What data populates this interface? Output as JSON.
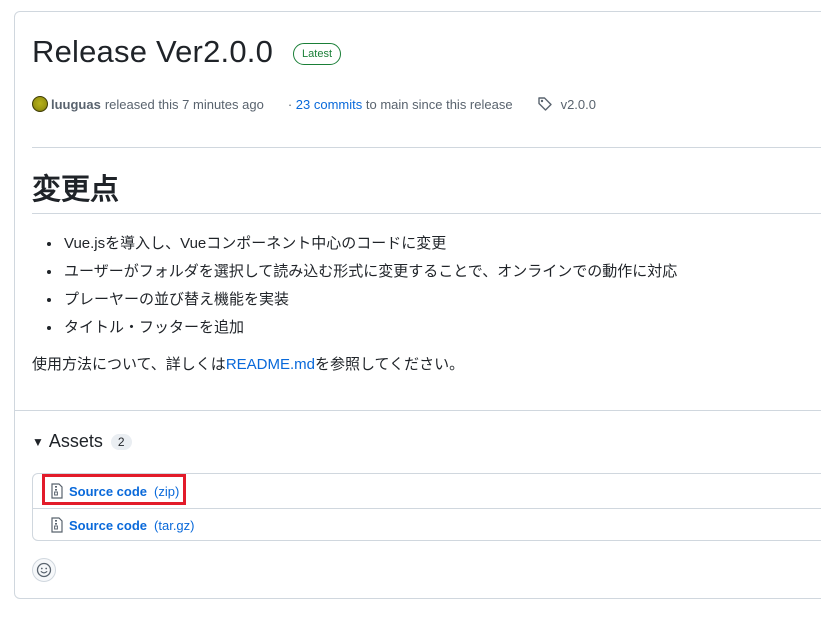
{
  "release": {
    "title": "Release Ver2.0.0",
    "badge": "Latest",
    "author": "luuguas",
    "released_text": "released this 7 minutes ago",
    "commits_prefix": "·",
    "commits_link": "23 commits",
    "commits_suffix": "to main since this release",
    "tag": "v2.0.0"
  },
  "notes": {
    "heading": "変更点",
    "bullets": [
      "Vue.jsを導入し、Vueコンポーネント中心のコードに変更",
      "ユーザーがフォルダを選択して読み込む形式に変更することで、オンラインでの動作に対応",
      "プレーヤーの並び替え機能を実装",
      "タイトル・フッターを追加"
    ],
    "usage_before": "使用方法について、詳しくは",
    "usage_link": "README.md",
    "usage_after": "を参照してください。"
  },
  "assets": {
    "label": "Assets",
    "count": "2",
    "items": [
      {
        "name": "Source code",
        "type": "(zip)"
      },
      {
        "name": "Source code",
        "type": "(tar.gz)"
      }
    ]
  },
  "icons": {
    "tag": "tag-icon",
    "zip": "file-zip-icon",
    "reaction": "smiley-icon",
    "caret": "triangle-down-icon"
  },
  "colors": {
    "link": "#0969da",
    "badge": "#1a7f37",
    "highlight": "#e21b2a",
    "border": "#d0d7de"
  }
}
